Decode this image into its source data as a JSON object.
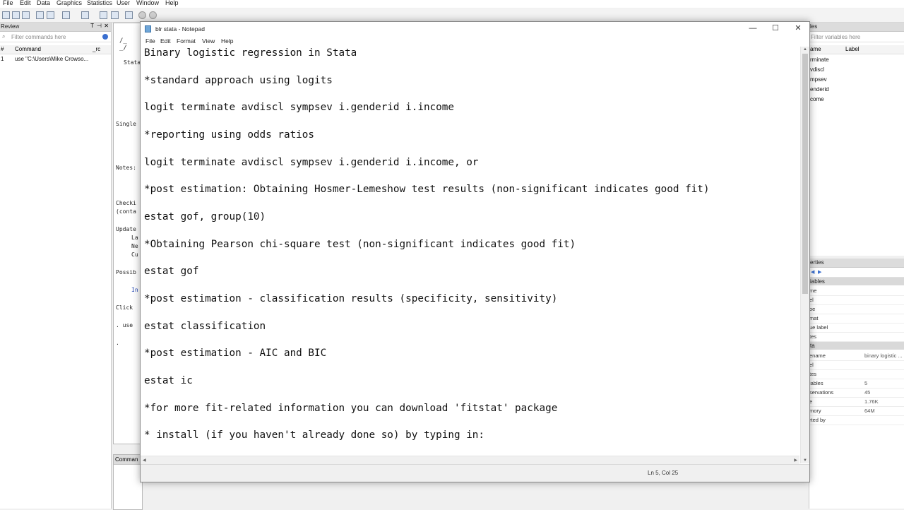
{
  "stata": {
    "menu": [
      "File",
      "Edit",
      "Data",
      "Graphics",
      "Statistics",
      "User",
      "Window",
      "Help"
    ],
    "review": {
      "title": "Review",
      "filter_placeholder": "Filter commands here",
      "col_num": "#",
      "col_command": "Command",
      "col_rc": "_rc",
      "rows": [
        {
          "num": "1",
          "command": "use \"C:\\Users\\Mike Crowso..."
        }
      ]
    },
    "results_fragments": [
      "Stata",
      "Single",
      "Notes:",
      "Checki",
      "(conta",
      "Update",
      "La",
      "Ne",
      "Cu",
      "Possib",
      "In",
      "Click",
      ". use",
      "."
    ],
    "command_title": "Comman",
    "variables": {
      "title": "les",
      "filter_placeholder": "Filter variables here",
      "col_name": "ame",
      "col_label": "Label",
      "items": [
        "rminate",
        "vdiscl",
        "mpsev",
        "enderid",
        "come"
      ]
    },
    "properties": {
      "title": "erties",
      "section_variables": "iables",
      "var_rows": [
        "me",
        "el",
        "oe",
        "mat",
        "ue label",
        "tes"
      ],
      "section_data": "ta",
      "data_rows": [
        {
          "k": "ename",
          "v": "binary logistic ..."
        },
        {
          "k": "el",
          "v": ""
        },
        {
          "k": "tes",
          "v": ""
        },
        {
          "k": "iables",
          "v": "5"
        },
        {
          "k": "servations",
          "v": "45"
        },
        {
          "k": "e",
          "v": "1.76K"
        },
        {
          "k": "mory",
          "v": "64M"
        },
        {
          "k": "rted by",
          "v": ""
        }
      ]
    }
  },
  "notepad": {
    "title": "blr stata - Notepad",
    "menu": [
      "File",
      "Edit",
      "Format",
      "View",
      "Help"
    ],
    "lines": [
      "Binary logistic regression in Stata",
      "*standard approach using logits",
      "logit terminate avdiscl sympsev i.genderid i.income",
      "*reporting using odds ratios",
      "logit terminate avdiscl sympsev i.genderid i.income, or",
      "*post estimation: Obtaining Hosmer-Lemeshow test results (non-significant indicates good fit)",
      "estat gof, group(10)",
      "*Obtaining Pearson chi-square test (non-significant indicates good fit)",
      "estat gof",
      "*post estimation - classification results (specificity, sensitivity)",
      "estat classification",
      "*post estimation - AIC and BIC",
      "estat ic",
      "*for more fit-related information you can download 'fitstat' package",
      "* install (if you haven't already done so) by typing in:"
    ],
    "status": "Ln 5, Col 25",
    "controls": {
      "minimize": "—",
      "maximize": "☐",
      "close": "✕"
    }
  }
}
